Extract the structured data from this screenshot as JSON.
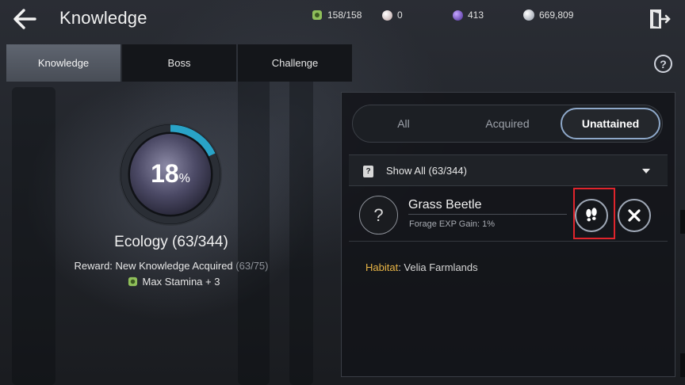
{
  "header": {
    "title": "Knowledge",
    "resources": [
      {
        "icon": "stamina-icon",
        "value": "158/158",
        "color": "#8fbf5a"
      },
      {
        "icon": "pearl-icon",
        "value": "0",
        "color": "#d9c6c6"
      },
      {
        "icon": "crystal-icon",
        "value": "413",
        "color": "#7a4fd0"
      },
      {
        "icon": "silver-icon",
        "value": "669,809",
        "color": "#c9ced6"
      }
    ]
  },
  "tabs": [
    {
      "label": "Knowledge",
      "active": true
    },
    {
      "label": "Boss",
      "active": false
    },
    {
      "label": "Challenge",
      "active": false
    }
  ],
  "progress": {
    "percent": 18,
    "percent_symbol": "%",
    "category": "Ecology (63/344)",
    "reward_label": "Reward: New Knowledge Acquired",
    "reward_count": "(63/75)",
    "bonus": "Max Stamina + 3",
    "ring_color": "#29a3c7"
  },
  "filter": {
    "options": [
      "All",
      "Acquired",
      "Unattained"
    ],
    "selected": "Unattained"
  },
  "dropdown": {
    "icon_glyph": "?",
    "label": "Show All (63/344)"
  },
  "entry": {
    "icon_glyph": "?",
    "name": "Grass Beetle",
    "subtitle": "Forage EXP Gain: 1%"
  },
  "habitat": {
    "key": "Habitat",
    "value": ": Velia Farmlands"
  }
}
